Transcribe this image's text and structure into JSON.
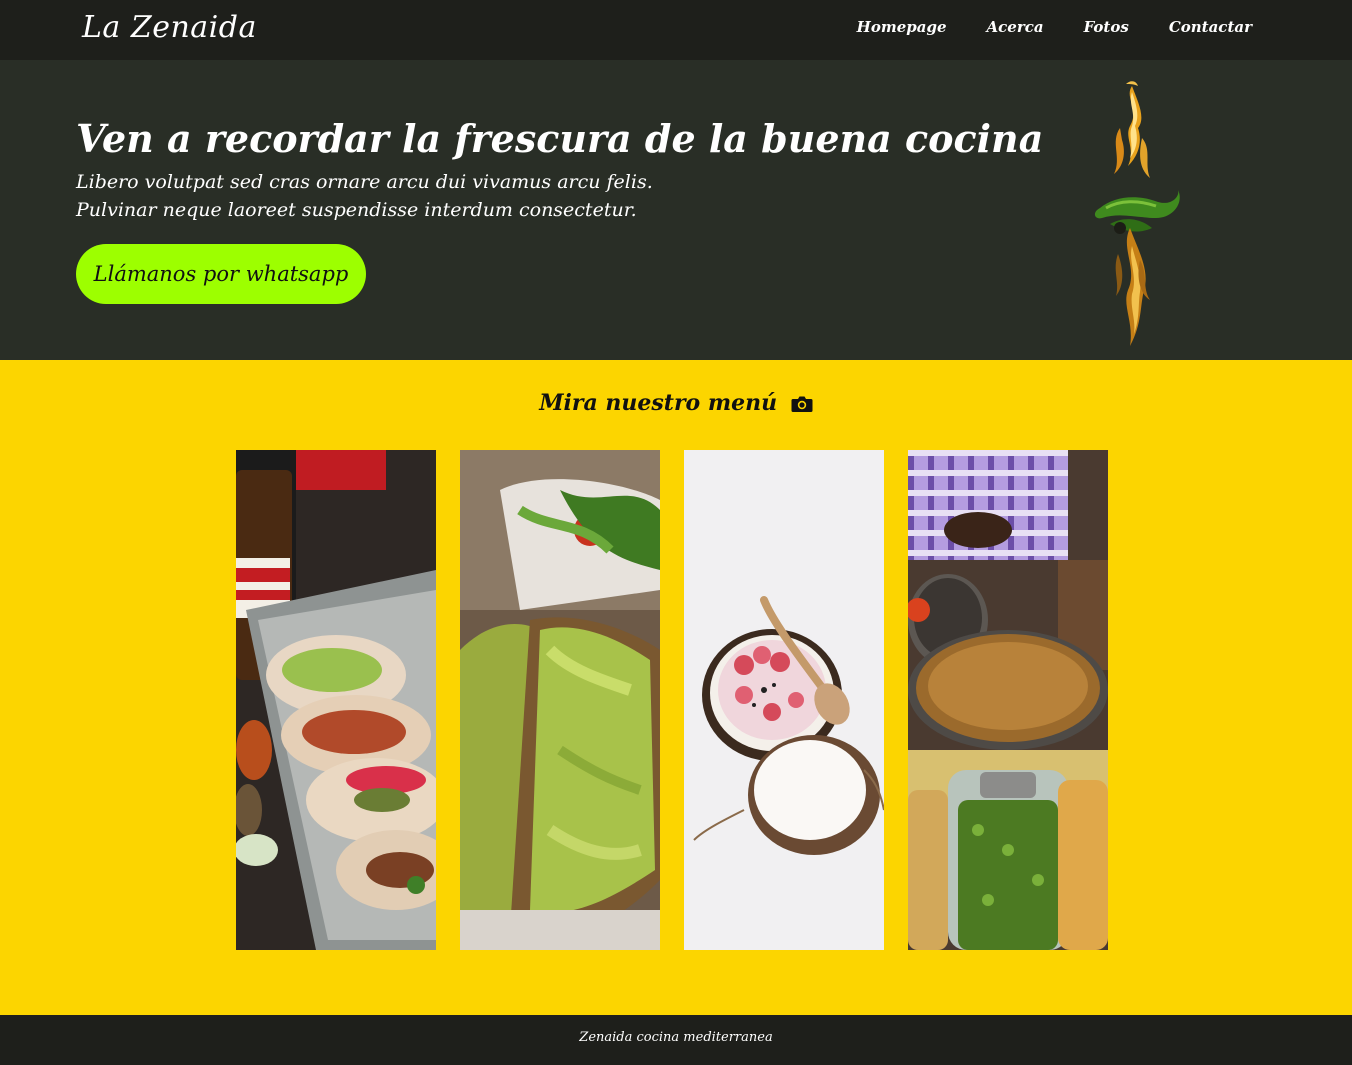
{
  "nav": {
    "brand": "La Zenaida",
    "links": [
      "Homepage",
      "Acerca",
      "Fotos",
      "Contactar"
    ]
  },
  "hero": {
    "title": "Ven a recordar la frescura de la buena cocina",
    "subtitle_lines": [
      "Libero volutpat sed cras ornare arcu dui vivamus arcu felis.",
      "Pulvinar neque laoreet suspendisse interdum consectetur."
    ],
    "cta_label": "Llámanos por whatsapp",
    "image": "flaming-chili-pepper"
  },
  "menu": {
    "heading": "Mira nuestro menú",
    "heading_icon": "camera-icon",
    "photos": [
      "tacos-and-beer-photo",
      "avocado-toast-photo",
      "coconut-bowl-photo",
      "market-stall-photo"
    ]
  },
  "footer": {
    "text": "Zenaida cocina mediterranea"
  },
  "colors": {
    "nav_bg": "#1e1f1b",
    "hero_bg": "#292e26",
    "cta_bg": "#9dff00",
    "menu_bg": "#fcd500"
  }
}
